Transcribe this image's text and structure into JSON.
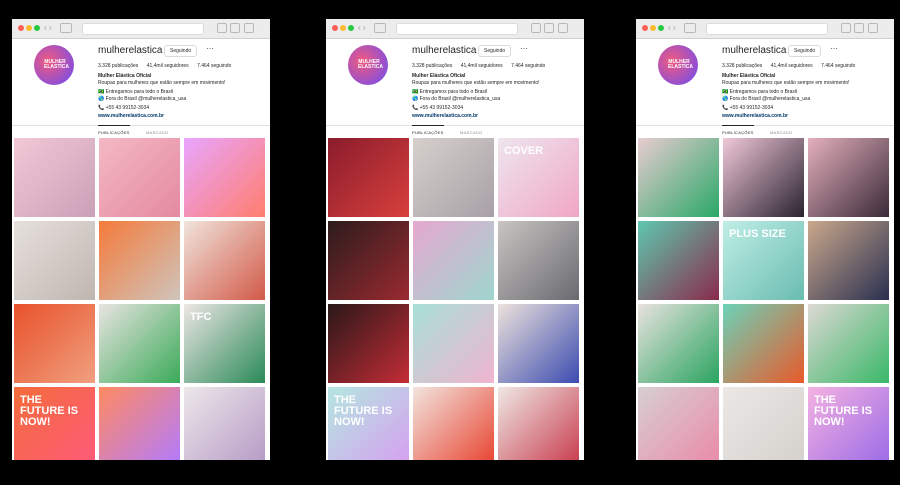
{
  "profile": {
    "username": "mulherelastica",
    "follow_button": "Seguindo",
    "more": "···",
    "posts_count": "3.328 publicações",
    "followers_count": "41,4mil seguidores",
    "following_count": "7.464 seguindo",
    "business_name": "Mulher Elástica Oficial",
    "bio_line_1": "Roupas para mulheres que estão sempre em movimento!",
    "bio_line_2": "🇧🇷 Entregamos para todo o Brasil",
    "bio_line_3": "🌎 Fora do Brasil @mulherelastica_usa",
    "bio_line_4": "📞 +55 43 99152-3034",
    "website": "www.mulherelastica.com.br",
    "avatar_text": "MULHER ELASTICA"
  },
  "tabs": {
    "posts": "PUBLICAÇÕES",
    "tagged": "MARCADO"
  },
  "windows": [
    {
      "tiles": [
        {
          "colors": [
            "#f2c8d6",
            "#caa0b8"
          ],
          "text": ""
        },
        {
          "colors": [
            "#f4b8c4",
            "#e48aa0"
          ],
          "text": ""
        },
        {
          "colors": [
            "#e8a6ff",
            "#ff7d6e"
          ],
          "text": ""
        },
        {
          "colors": [
            "#e6e0dc",
            "#c0b6b0"
          ],
          "text": ""
        },
        {
          "colors": [
            "#f57a3a",
            "#d0c4bc"
          ],
          "text": ""
        },
        {
          "colors": [
            "#f0e4dc",
            "#d25a48"
          ],
          "text": ""
        },
        {
          "colors": [
            "#e8522a",
            "#f0a080"
          ],
          "text": ""
        },
        {
          "colors": [
            "#e8e4e0",
            "#3aaa58"
          ],
          "text": ""
        },
        {
          "colors": [
            "#ece6e4",
            "#2a8a58"
          ],
          "text": "TFC"
        },
        {
          "colors": [
            "#f36c3a",
            "#ff5a7a"
          ],
          "text": "THE FUTURE IS NOW!"
        },
        {
          "colors": [
            "#ff8a62",
            "#b07bff"
          ],
          "text": ""
        },
        {
          "colors": [
            "#ede7ea",
            "#b59ac5"
          ],
          "text": ""
        }
      ]
    },
    {
      "tiles": [
        {
          "colors": [
            "#8a1c2c",
            "#d8403c"
          ],
          "text": ""
        },
        {
          "colors": [
            "#d6d0cc",
            "#a8a0a6"
          ],
          "text": ""
        },
        {
          "colors": [
            "#ede6ee",
            "#f0a6c6"
          ],
          "text": "COVER"
        },
        {
          "colors": [
            "#2c1c1c",
            "#9a2a30"
          ],
          "text": ""
        },
        {
          "colors": [
            "#e6a8d0",
            "#9ed6ce"
          ],
          "text": ""
        },
        {
          "colors": [
            "#c8c4c2",
            "#6a6a70"
          ],
          "text": ""
        },
        {
          "colors": [
            "#2a1818",
            "#c42c36"
          ],
          "text": ""
        },
        {
          "colors": [
            "#a8e0d6",
            "#f0b4d0"
          ],
          "text": ""
        },
        {
          "colors": [
            "#ece2dc",
            "#3c4cb0"
          ],
          "text": ""
        },
        {
          "colors": [
            "#b4e6e0",
            "#d6a0f0"
          ],
          "text": "THE FUTURE IS NOW!"
        },
        {
          "colors": [
            "#f2e4de",
            "#e8422e"
          ],
          "text": ""
        },
        {
          "colors": [
            "#eee8e4",
            "#c83a4c"
          ],
          "text": ""
        }
      ]
    },
    {
      "tiles": [
        {
          "colors": [
            "#e8ccd0",
            "#2aa868"
          ],
          "text": ""
        },
        {
          "colors": [
            "#f0c8d8",
            "#2a2230"
          ],
          "text": ""
        },
        {
          "colors": [
            "#e4b0bc",
            "#3a2a38"
          ],
          "text": ""
        },
        {
          "colors": [
            "#5ec8ae",
            "#8a2a4c"
          ],
          "text": ""
        },
        {
          "colors": [
            "#bfeee6",
            "#6abcb0"
          ],
          "text": "PLUS SIZE"
        },
        {
          "colors": [
            "#caa88c",
            "#2a3050"
          ],
          "text": ""
        },
        {
          "colors": [
            "#e8e2de",
            "#2aa460"
          ],
          "text": ""
        },
        {
          "colors": [
            "#6cd2b8",
            "#e85a2a"
          ],
          "text": ""
        },
        {
          "colors": [
            "#dcd8d2",
            "#3ab868"
          ],
          "text": ""
        },
        {
          "colors": [
            "#d6cfd2",
            "#ea8aa8"
          ],
          "text": ""
        },
        {
          "colors": [
            "#ece8e6",
            "#d4d0cc"
          ],
          "text": ""
        },
        {
          "colors": [
            "#f4b2e2",
            "#9a6ae6"
          ],
          "text": "THE FUTURE IS NOW!"
        }
      ]
    }
  ]
}
